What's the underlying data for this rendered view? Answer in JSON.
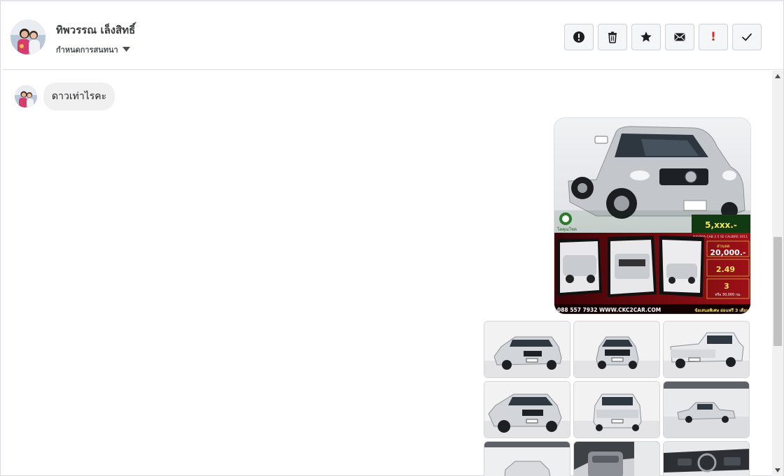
{
  "header": {
    "contact_name": "ทิพวรรณ เล็งสิทธิ์",
    "conversation_menu_label": "กำหนดการสนทนา",
    "actions": [
      {
        "name": "mark-spam",
        "icon": "exclamation-circle-icon"
      },
      {
        "name": "delete",
        "icon": "trash-icon"
      },
      {
        "name": "star",
        "icon": "star-icon"
      },
      {
        "name": "mark-unread",
        "icon": "envelope-icon"
      },
      {
        "name": "important",
        "icon": "exclamation-mark-icon"
      },
      {
        "name": "done",
        "icon": "check-icon"
      }
    ]
  },
  "messages": [
    {
      "from": "contact",
      "text": "ดาวเท่าไรคะ"
    }
  ],
  "ad_image": {
    "brand": "โตคุณโชค",
    "installment": "5,xxx.-",
    "model": "NAVARA CAB 2.5 SE CALIBRE 2011",
    "discount_label": "ส่วนลด",
    "discount": "20,000.-",
    "rate": "2.49",
    "warranty_years": "3",
    "warranty_km": "หรือ 30,000 กม.",
    "contact": "088 557 7932 WWW.CKC2CAR.COM",
    "promo": "ข้อเสนอพิเศษ ผ่อนฟรี 3 เดือน"
  },
  "colors": {
    "car_silver": "#c8ccd1",
    "ad_red": "#8a0b10",
    "ad_green": "#1f5b1c",
    "accent_yellow": "#f6e25b"
  },
  "thumbnails": [
    {
      "view": "front-3q-left"
    },
    {
      "view": "front"
    },
    {
      "view": "rear-3q"
    },
    {
      "view": "front-3q-left-near"
    },
    {
      "view": "rear"
    },
    {
      "view": "side-far"
    },
    {
      "view": "side-partial"
    },
    {
      "view": "door-interior"
    },
    {
      "view": "dashboard"
    }
  ]
}
